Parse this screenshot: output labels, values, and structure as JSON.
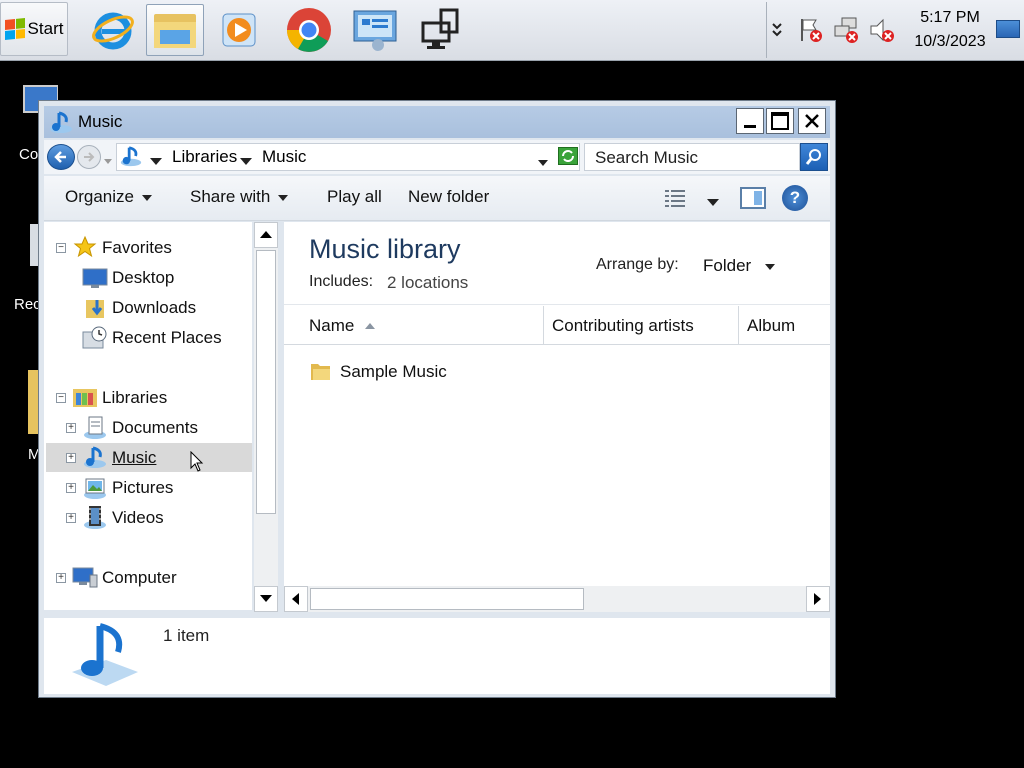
{
  "taskbar": {
    "start_label": "Start",
    "apps": [
      {
        "name": "internet-explorer",
        "icon": "ie-icon"
      },
      {
        "name": "file-explorer",
        "icon": "folder-icon",
        "active": true
      },
      {
        "name": "media-player",
        "icon": "media-player-icon"
      },
      {
        "name": "chrome",
        "icon": "chrome-icon"
      },
      {
        "name": "control-panel",
        "icon": "control-panel-icon"
      },
      {
        "name": "network",
        "icon": "network-icon"
      }
    ],
    "clock": {
      "time": "5:17 PM",
      "date": "10/3/2023"
    }
  },
  "desktop": {
    "icon_labels": [
      "Co",
      "Rec",
      "M"
    ]
  },
  "window": {
    "title": "Music",
    "address": {
      "crumbs": [
        "Libraries",
        "Music"
      ]
    },
    "search_placeholder": "Search Music",
    "commands": {
      "organize": "Organize",
      "share_with": "Share with",
      "play_all": "Play all",
      "new_folder": "New folder"
    },
    "nav": {
      "favorites": {
        "label": "Favorites",
        "items": [
          "Desktop",
          "Downloads",
          "Recent Places"
        ]
      },
      "libraries": {
        "label": "Libraries",
        "items": [
          "Documents",
          "Music",
          "Pictures",
          "Videos"
        ]
      },
      "computer": "Computer",
      "selected": "Music"
    },
    "library": {
      "title": "Music library",
      "includes_label": "Includes:",
      "includes_value": "2 locations",
      "arrange_label": "Arrange by:",
      "arrange_value": "Folder"
    },
    "columns": [
      "Name",
      "Contributing artists",
      "Album"
    ],
    "files": [
      {
        "name": "Sample Music",
        "type": "folder"
      }
    ],
    "details": {
      "count": "1 item"
    }
  },
  "colors": {
    "accent": "#1c5fb4",
    "title_bar": "#b0c6e1",
    "selection": "#d9d9d9"
  }
}
